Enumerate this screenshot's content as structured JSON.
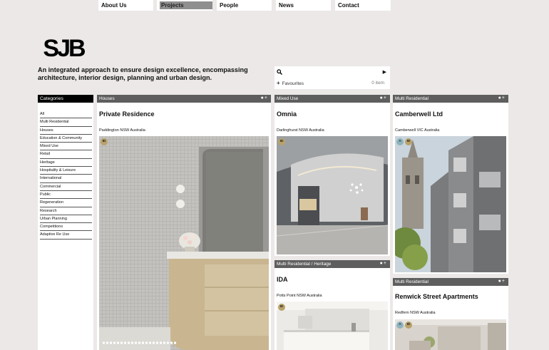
{
  "nav": {
    "items": [
      "About Us",
      "Projects",
      "People",
      "News",
      "Contact"
    ],
    "active": "Projects"
  },
  "logo": {
    "text": "SJB"
  },
  "tagline": "An integrated approach to ensure design excellence, encompassing architecture, interior design, planning and urban design.",
  "search": {
    "placeholder": "",
    "favourites_label": "Favourites",
    "favourites_count": "0 item"
  },
  "categories": {
    "header": "Categories",
    "items": [
      "All",
      "Multi Residential",
      "Houses",
      "Education & Community",
      "Mixed Use",
      "Retail",
      "Heritage",
      "Hospitality & Leisure",
      "International",
      "Commercial",
      "Public",
      "Regeneration",
      "Research",
      "Urban Planning",
      "Competitions",
      "Adaptive Re Use"
    ]
  },
  "projects": [
    {
      "category": "Houses",
      "title": "Private Residence",
      "location": "Paddington NSW Australia",
      "badges": [
        "ID"
      ]
    },
    {
      "category": "Mixed Use",
      "title": "Omnia",
      "location": "Darlinghurst NSW Australia",
      "badges": [
        "ID"
      ]
    },
    {
      "category": "Multi Residential",
      "title": "Camberwell Ltd",
      "location": "Camberwell VIC Australia",
      "badges": [
        "A",
        "ID"
      ]
    },
    {
      "category": "Multi Residential / Heritage",
      "title": "IDA",
      "location": "Potts Point NSW Australia",
      "badges": [
        "ID"
      ]
    },
    {
      "category": "Multi Residential",
      "title": "Renwick Street Apartments",
      "location": "Redfern NSW Australia",
      "badges": [
        "A",
        "ID"
      ]
    }
  ],
  "controls": {
    "card_ctl": "●+",
    "search_arrow": "▶",
    "fav_plus": "+"
  },
  "colors": {
    "background": "#ebe8e7",
    "card_bar": "#5e5e5e",
    "category_header": "#000000",
    "badge_id": "#b9a26a",
    "badge_a": "#8fb3bd"
  }
}
